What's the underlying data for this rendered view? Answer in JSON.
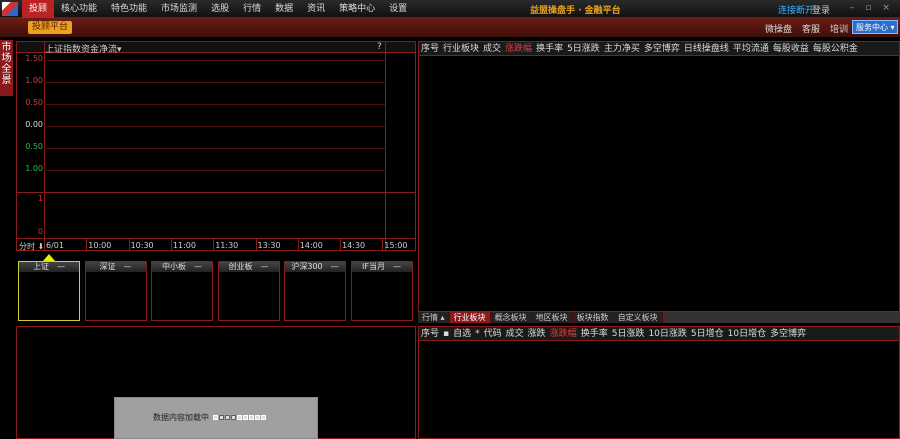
{
  "titlebar": {
    "app_title": "益盟操盘手 · 金融平台",
    "connection": "连接断开",
    "login": "登录",
    "window_controls": "– ▫ ×",
    "menu": [
      "投顾",
      "核心功能",
      "特色功能",
      "市场监测",
      "选股",
      "行情",
      "数据",
      "资讯",
      "策略中心",
      "设置"
    ]
  },
  "toolbar": {
    "advisor_platform": "投顾平台",
    "links": [
      "微操盘",
      "客服",
      "培训"
    ],
    "service_center": "服务中心"
  },
  "sidebar": {
    "tab": "市场全景"
  },
  "chart": {
    "index_label": "上证指数",
    "indicator": "资金净流▾",
    "help": "?",
    "y_labels": [
      {
        "v": "1.50",
        "c": "#d04040"
      },
      {
        "v": "1.00",
        "c": "#d04040"
      },
      {
        "v": "0.50",
        "c": "#d04040"
      },
      {
        "v": "0.00",
        "c": "#dddddd"
      },
      {
        "v": "0.50",
        "c": "#20c040"
      },
      {
        "v": "1.00",
        "c": "#20c040"
      }
    ],
    "lower_y": [
      "1",
      "0"
    ],
    "period": "分时",
    "x_labels": [
      "6/01",
      "10:00",
      "10:30",
      "11:00",
      "11:30",
      "13:30",
      "14:00",
      "14:30",
      "15:00"
    ]
  },
  "indices": [
    {
      "name": "上证",
      "val": "—"
    },
    {
      "name": "深证",
      "val": "—"
    },
    {
      "name": "中小板",
      "val": "—"
    },
    {
      "name": "创业板",
      "val": "—"
    },
    {
      "name": "沪深300",
      "val": "—"
    },
    {
      "name": "IF当月",
      "val": "—"
    }
  ],
  "sector_table": {
    "columns": [
      "序号",
      "行业板块",
      "成交",
      "涨跌幅",
      "换手率",
      "5日涨跌",
      "主力净买",
      "多空博弈",
      "日线操盘线",
      "平均流通",
      "每股收益",
      "每股公积金"
    ],
    "sorted": "涨跌幅"
  },
  "sector_tabs": [
    "行情 ▴",
    "行业板块",
    "概念板块",
    "地区板块",
    "板块指数",
    "自定义板块"
  ],
  "stock_table": {
    "columns": [
      "序号",
      "▪",
      "自选",
      "*",
      "代码",
      "成交",
      "涨跌",
      "涨跌幅",
      "换手率",
      "5日涨跌",
      "10日涨跌",
      "5日增仓",
      "10日增仓",
      "多空博弈"
    ],
    "sorted": "涨跌幅"
  },
  "loading": {
    "text": "数据内容加载中"
  }
}
